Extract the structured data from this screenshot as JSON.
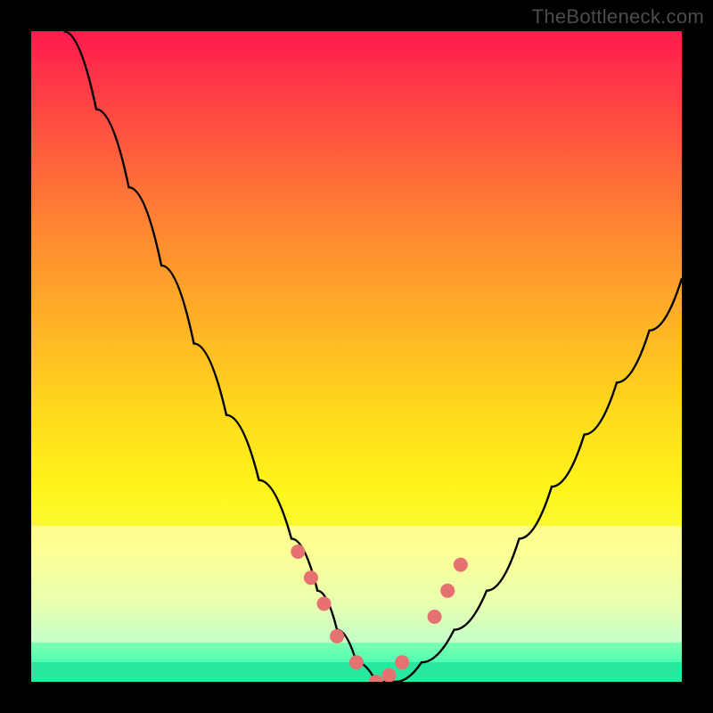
{
  "watermark": "TheBottleneck.com",
  "colors": {
    "black": "#000000",
    "curve_stroke": "#000000",
    "dot_fill": "#e57171",
    "band_pale": "rgba(255,255,220,0.55)",
    "band_green": "#28e8a0"
  },
  "chart_data": {
    "type": "line",
    "title": "",
    "xlabel": "",
    "ylabel": "",
    "xlim": [
      0,
      100
    ],
    "ylim": [
      0,
      100
    ],
    "series": [
      {
        "name": "bottleneck-curve",
        "x": [
          5,
          10,
          15,
          20,
          25,
          30,
          35,
          40,
          44,
          47,
          50,
          53,
          56,
          60,
          65,
          70,
          75,
          80,
          85,
          90,
          95,
          100
        ],
        "values": [
          100,
          88,
          76,
          64,
          52,
          41,
          31,
          22,
          14,
          8,
          3,
          0,
          0,
          3,
          8,
          14,
          22,
          30,
          38,
          46,
          54,
          62
        ]
      }
    ],
    "markers": {
      "name": "highlight-dots",
      "x": [
        41,
        43,
        45,
        47,
        50,
        53,
        55,
        57,
        62,
        64,
        66
      ],
      "values": [
        20,
        16,
        12,
        7,
        3,
        0,
        1,
        3,
        10,
        14,
        18
      ]
    },
    "bands": [
      {
        "name": "pale-band",
        "y_from": 24,
        "y_to": 6
      },
      {
        "name": "green-band",
        "y_from": 3,
        "y_to": 0
      }
    ]
  }
}
